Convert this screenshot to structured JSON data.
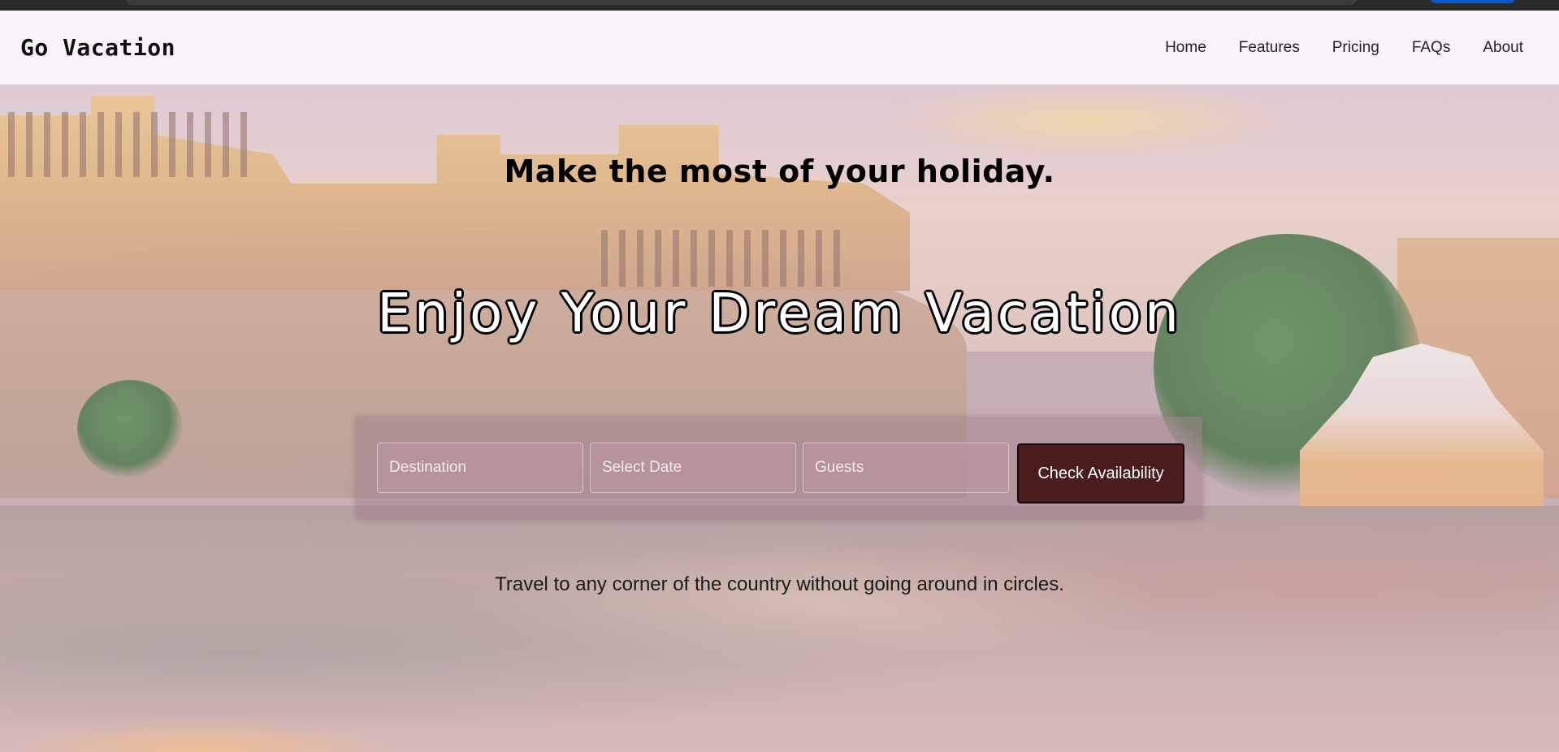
{
  "navbar": {
    "brand": "Go Vacation",
    "links": [
      "Home",
      "Features",
      "Pricing",
      "FAQs",
      "About"
    ]
  },
  "hero": {
    "tagline": "Make the most of your holiday.",
    "title": "Enjoy Your Dream Vacation",
    "subtext": "Travel to any corner of the country without going around in circles."
  },
  "search": {
    "destination_placeholder": "Destination",
    "date_placeholder": "Select Date",
    "guests_placeholder": "Guests",
    "button_label": "Check Availability"
  },
  "colors": {
    "button_bg": "#4a1c1e",
    "navbar_bg": "#faf6fa"
  }
}
